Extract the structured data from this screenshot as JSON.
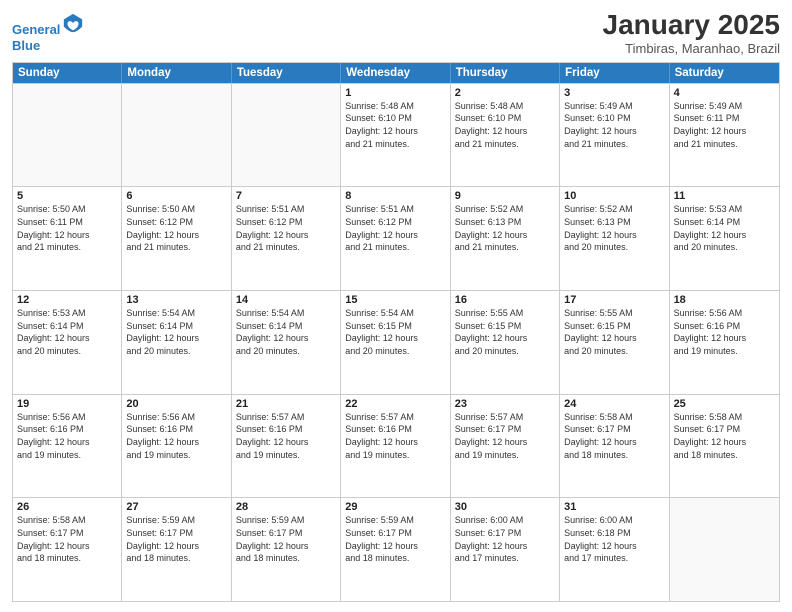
{
  "header": {
    "logo_line1": "General",
    "logo_line2": "Blue",
    "month_title": "January 2025",
    "location": "Timbiras, Maranhao, Brazil"
  },
  "days_of_week": [
    "Sunday",
    "Monday",
    "Tuesday",
    "Wednesday",
    "Thursday",
    "Friday",
    "Saturday"
  ],
  "weeks": [
    [
      {
        "num": "",
        "info": "",
        "empty": true
      },
      {
        "num": "",
        "info": "",
        "empty": true
      },
      {
        "num": "",
        "info": "",
        "empty": true
      },
      {
        "num": "1",
        "info": "Sunrise: 5:48 AM\nSunset: 6:10 PM\nDaylight: 12 hours\nand 21 minutes.",
        "empty": false
      },
      {
        "num": "2",
        "info": "Sunrise: 5:48 AM\nSunset: 6:10 PM\nDaylight: 12 hours\nand 21 minutes.",
        "empty": false
      },
      {
        "num": "3",
        "info": "Sunrise: 5:49 AM\nSunset: 6:10 PM\nDaylight: 12 hours\nand 21 minutes.",
        "empty": false
      },
      {
        "num": "4",
        "info": "Sunrise: 5:49 AM\nSunset: 6:11 PM\nDaylight: 12 hours\nand 21 minutes.",
        "empty": false
      }
    ],
    [
      {
        "num": "5",
        "info": "Sunrise: 5:50 AM\nSunset: 6:11 PM\nDaylight: 12 hours\nand 21 minutes.",
        "empty": false
      },
      {
        "num": "6",
        "info": "Sunrise: 5:50 AM\nSunset: 6:12 PM\nDaylight: 12 hours\nand 21 minutes.",
        "empty": false
      },
      {
        "num": "7",
        "info": "Sunrise: 5:51 AM\nSunset: 6:12 PM\nDaylight: 12 hours\nand 21 minutes.",
        "empty": false
      },
      {
        "num": "8",
        "info": "Sunrise: 5:51 AM\nSunset: 6:12 PM\nDaylight: 12 hours\nand 21 minutes.",
        "empty": false
      },
      {
        "num": "9",
        "info": "Sunrise: 5:52 AM\nSunset: 6:13 PM\nDaylight: 12 hours\nand 21 minutes.",
        "empty": false
      },
      {
        "num": "10",
        "info": "Sunrise: 5:52 AM\nSunset: 6:13 PM\nDaylight: 12 hours\nand 20 minutes.",
        "empty": false
      },
      {
        "num": "11",
        "info": "Sunrise: 5:53 AM\nSunset: 6:14 PM\nDaylight: 12 hours\nand 20 minutes.",
        "empty": false
      }
    ],
    [
      {
        "num": "12",
        "info": "Sunrise: 5:53 AM\nSunset: 6:14 PM\nDaylight: 12 hours\nand 20 minutes.",
        "empty": false
      },
      {
        "num": "13",
        "info": "Sunrise: 5:54 AM\nSunset: 6:14 PM\nDaylight: 12 hours\nand 20 minutes.",
        "empty": false
      },
      {
        "num": "14",
        "info": "Sunrise: 5:54 AM\nSunset: 6:14 PM\nDaylight: 12 hours\nand 20 minutes.",
        "empty": false
      },
      {
        "num": "15",
        "info": "Sunrise: 5:54 AM\nSunset: 6:15 PM\nDaylight: 12 hours\nand 20 minutes.",
        "empty": false
      },
      {
        "num": "16",
        "info": "Sunrise: 5:55 AM\nSunset: 6:15 PM\nDaylight: 12 hours\nand 20 minutes.",
        "empty": false
      },
      {
        "num": "17",
        "info": "Sunrise: 5:55 AM\nSunset: 6:15 PM\nDaylight: 12 hours\nand 20 minutes.",
        "empty": false
      },
      {
        "num": "18",
        "info": "Sunrise: 5:56 AM\nSunset: 6:16 PM\nDaylight: 12 hours\nand 19 minutes.",
        "empty": false
      }
    ],
    [
      {
        "num": "19",
        "info": "Sunrise: 5:56 AM\nSunset: 6:16 PM\nDaylight: 12 hours\nand 19 minutes.",
        "empty": false
      },
      {
        "num": "20",
        "info": "Sunrise: 5:56 AM\nSunset: 6:16 PM\nDaylight: 12 hours\nand 19 minutes.",
        "empty": false
      },
      {
        "num": "21",
        "info": "Sunrise: 5:57 AM\nSunset: 6:16 PM\nDaylight: 12 hours\nand 19 minutes.",
        "empty": false
      },
      {
        "num": "22",
        "info": "Sunrise: 5:57 AM\nSunset: 6:16 PM\nDaylight: 12 hours\nand 19 minutes.",
        "empty": false
      },
      {
        "num": "23",
        "info": "Sunrise: 5:57 AM\nSunset: 6:17 PM\nDaylight: 12 hours\nand 19 minutes.",
        "empty": false
      },
      {
        "num": "24",
        "info": "Sunrise: 5:58 AM\nSunset: 6:17 PM\nDaylight: 12 hours\nand 18 minutes.",
        "empty": false
      },
      {
        "num": "25",
        "info": "Sunrise: 5:58 AM\nSunset: 6:17 PM\nDaylight: 12 hours\nand 18 minutes.",
        "empty": false
      }
    ],
    [
      {
        "num": "26",
        "info": "Sunrise: 5:58 AM\nSunset: 6:17 PM\nDaylight: 12 hours\nand 18 minutes.",
        "empty": false
      },
      {
        "num": "27",
        "info": "Sunrise: 5:59 AM\nSunset: 6:17 PM\nDaylight: 12 hours\nand 18 minutes.",
        "empty": false
      },
      {
        "num": "28",
        "info": "Sunrise: 5:59 AM\nSunset: 6:17 PM\nDaylight: 12 hours\nand 18 minutes.",
        "empty": false
      },
      {
        "num": "29",
        "info": "Sunrise: 5:59 AM\nSunset: 6:17 PM\nDaylight: 12 hours\nand 18 minutes.",
        "empty": false
      },
      {
        "num": "30",
        "info": "Sunrise: 6:00 AM\nSunset: 6:17 PM\nDaylight: 12 hours\nand 17 minutes.",
        "empty": false
      },
      {
        "num": "31",
        "info": "Sunrise: 6:00 AM\nSunset: 6:18 PM\nDaylight: 12 hours\nand 17 minutes.",
        "empty": false
      },
      {
        "num": "",
        "info": "",
        "empty": true
      }
    ]
  ]
}
